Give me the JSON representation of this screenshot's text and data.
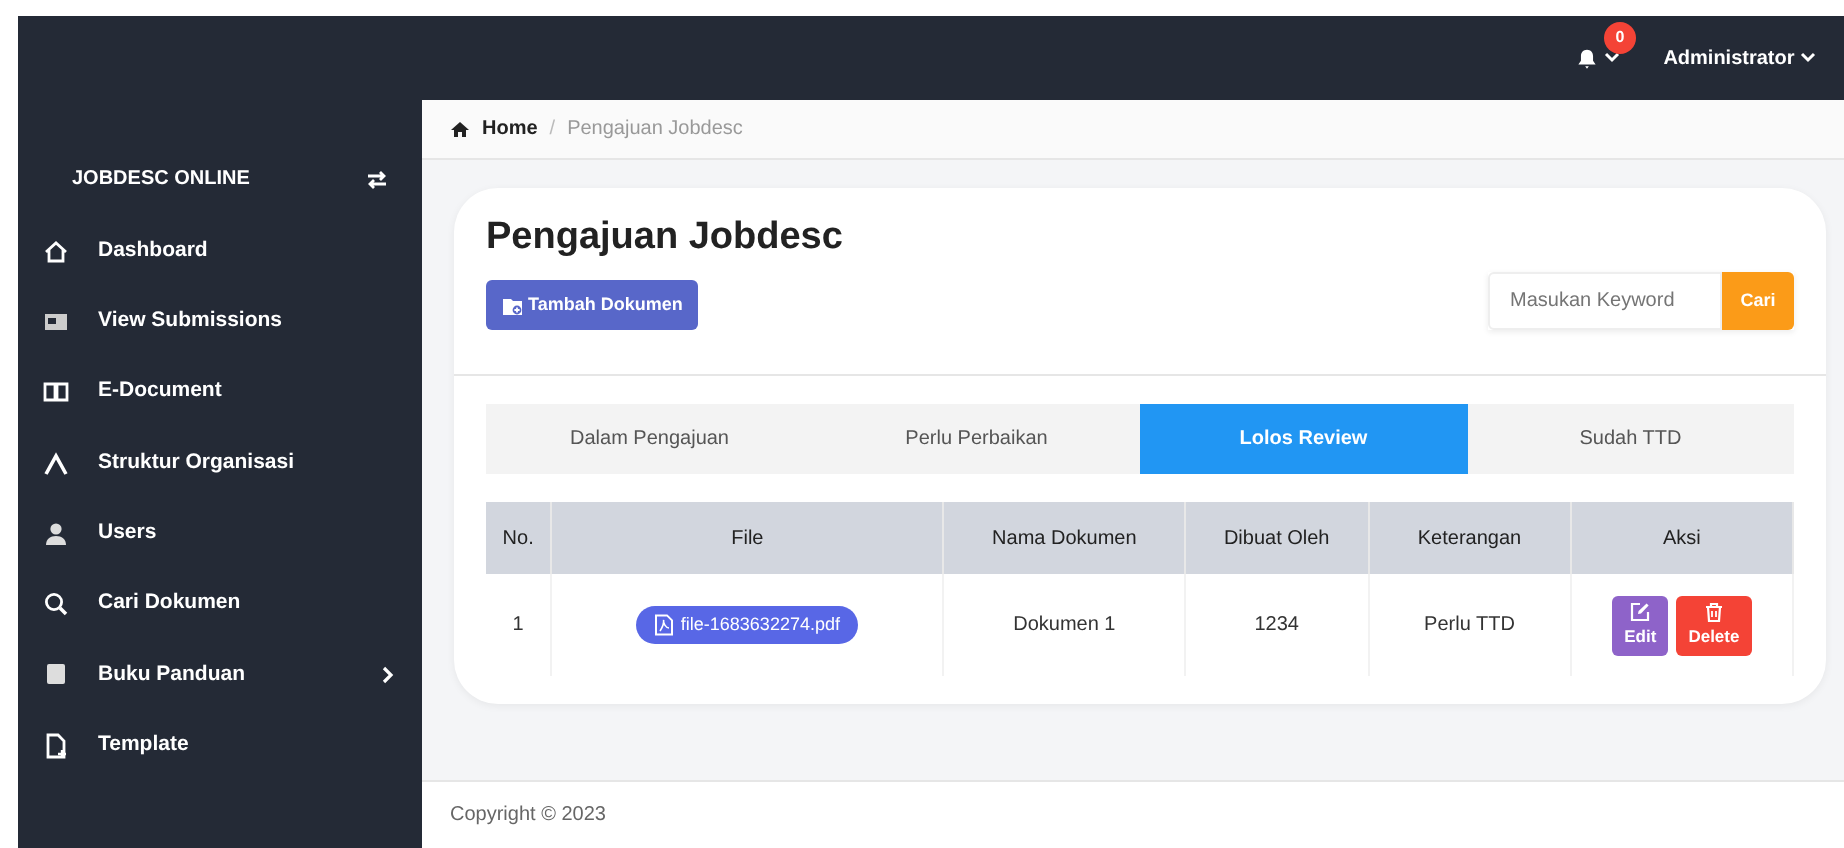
{
  "navbar": {
    "notification_count": "0",
    "user": "Administrator"
  },
  "sidebar": {
    "brand": "JOBDESC ONLINE",
    "items": [
      {
        "label": "Dashboard",
        "submenu": false
      },
      {
        "label": "View Submissions",
        "submenu": false
      },
      {
        "label": "E-Document",
        "submenu": false
      },
      {
        "label": "Struktur Organisasi",
        "submenu": false
      },
      {
        "label": "Users",
        "submenu": false
      },
      {
        "label": "Cari Dokumen",
        "submenu": false
      },
      {
        "label": "Buku Panduan",
        "submenu": true
      },
      {
        "label": "Template",
        "submenu": false
      }
    ]
  },
  "breadcrumb": {
    "home": "Home",
    "separator": "/",
    "current": "Pengajuan Jobdesc"
  },
  "page_title": "Pengajuan Jobdesc",
  "add_button": "Tambah Dokumen",
  "search": {
    "placeholder": "Masukan Keyword",
    "button": "Cari"
  },
  "tabs": [
    {
      "label": "Dalam Pengajuan",
      "selected": false
    },
    {
      "label": "Perlu Perbaikan",
      "selected": false
    },
    {
      "label": "Lolos Review",
      "selected": true
    },
    {
      "label": "Sudah TTD",
      "selected": false
    }
  ],
  "table": {
    "columns": [
      "No.",
      "File",
      "Nama Dokumen",
      "Dibuat Oleh",
      "Keterangan",
      "Aksi"
    ],
    "rows": [
      {
        "no": "1",
        "file": "file-1683632274.pdf",
        "name": "Dokumen 1",
        "created_by": "1234",
        "note": "Perlu TTD",
        "actions": [
          "Edit",
          "Delete"
        ]
      }
    ]
  },
  "footer": "Copyright © 2023"
}
